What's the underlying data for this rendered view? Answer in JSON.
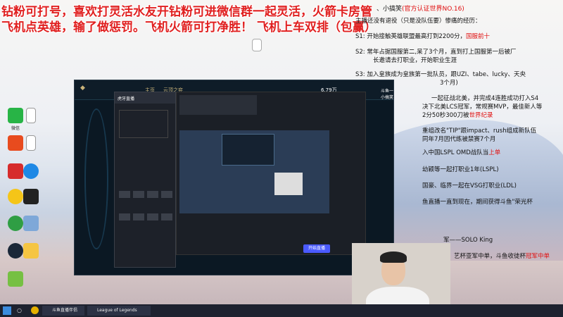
{
  "overlay": {
    "line1": "钻粉可打号，喜欢打灵活水友开钻粉可进微信群一起灵活，火箭卡房管",
    "line2": "飞机点英雄，输了做惩罚。飞机火箭可打净胜！  飞机上车双排（包赢）"
  },
  "info": {
    "header": "、小搞笑",
    "header_badge": "(官方认证世界NO.16)",
    "intro": "主播还没有退役（只是没队伍要）惨痛的经历：",
    "s1": "S1:  开始接触英雄联盟最高打到2200分，",
    "s1_red": "国服前十",
    "s2a": "S2:  常年占据国服第二,呆了3个月，直到打上国服第一后被厂",
    "s2b": "长邀请去打职业，开始职业生涯",
    "s3a": "S3:  加入皇族成为皇族第一批队员，跟UZI、tabe、lucky、天央",
    "s3b": "3个月)",
    "s4a": "一起征战北美，并完成4连胜成功打入S4",
    "s4b": "决下北美LCS冠军，常规赛MVP，最佳新人等",
    "s4c": "2分50秒300刀被",
    "s4c_red": "世界纪录",
    "s5a": "重组改名\"TIP\"跟impact、rush组成新队伍",
    "s5b": "同年7月因代练被禁赛7个月",
    "s6": "入中国LSPL OMD战队当",
    "s6_red": "上单",
    "s7": "幼颖等一起打职业1年(LSPL)",
    "s8": "国豪、临界一起在VSG打职业(LDL)",
    "s9": "鱼直播一直到现在，期间获得斗鱼\"荣光杯",
    "s10": "军——SOLO King",
    "s11": "艺杯亚军中单，斗鱼收徒杯",
    "s11_red": "冠军中单"
  },
  "desktop_icons": [
    {
      "label": "微信",
      "color": "#28b446"
    },
    {
      "label": "",
      "color": "#ffffff"
    },
    {
      "label": "",
      "color": "#e84b1e"
    },
    {
      "label": "",
      "color": "#ffffff"
    },
    {
      "label": "",
      "color": "#d62b2b"
    },
    {
      "label": "",
      "color": "#1e88e5"
    },
    {
      "label": "",
      "color": "#f5c518"
    },
    {
      "label": "",
      "color": "#222222"
    },
    {
      "label": "",
      "color": "#2f9e44"
    },
    {
      "label": "",
      "color": "#7ea8d8"
    },
    {
      "label": "",
      "color": "#1b2838"
    },
    {
      "label": "",
      "color": "#f5c542"
    },
    {
      "label": "",
      "color": "#76c043"
    }
  ],
  "lol_window": {
    "home": "主页",
    "tft": "云顶之弈",
    "currency": "6.79万",
    "username": "斗鱼一小搞笑"
  },
  "huya": {
    "title": "虎牙直播"
  },
  "stream": {
    "start_live": "开始直播"
  },
  "taskbar": {
    "app1": "斗鱼直播伴侣",
    "app2": "League of Legends"
  }
}
